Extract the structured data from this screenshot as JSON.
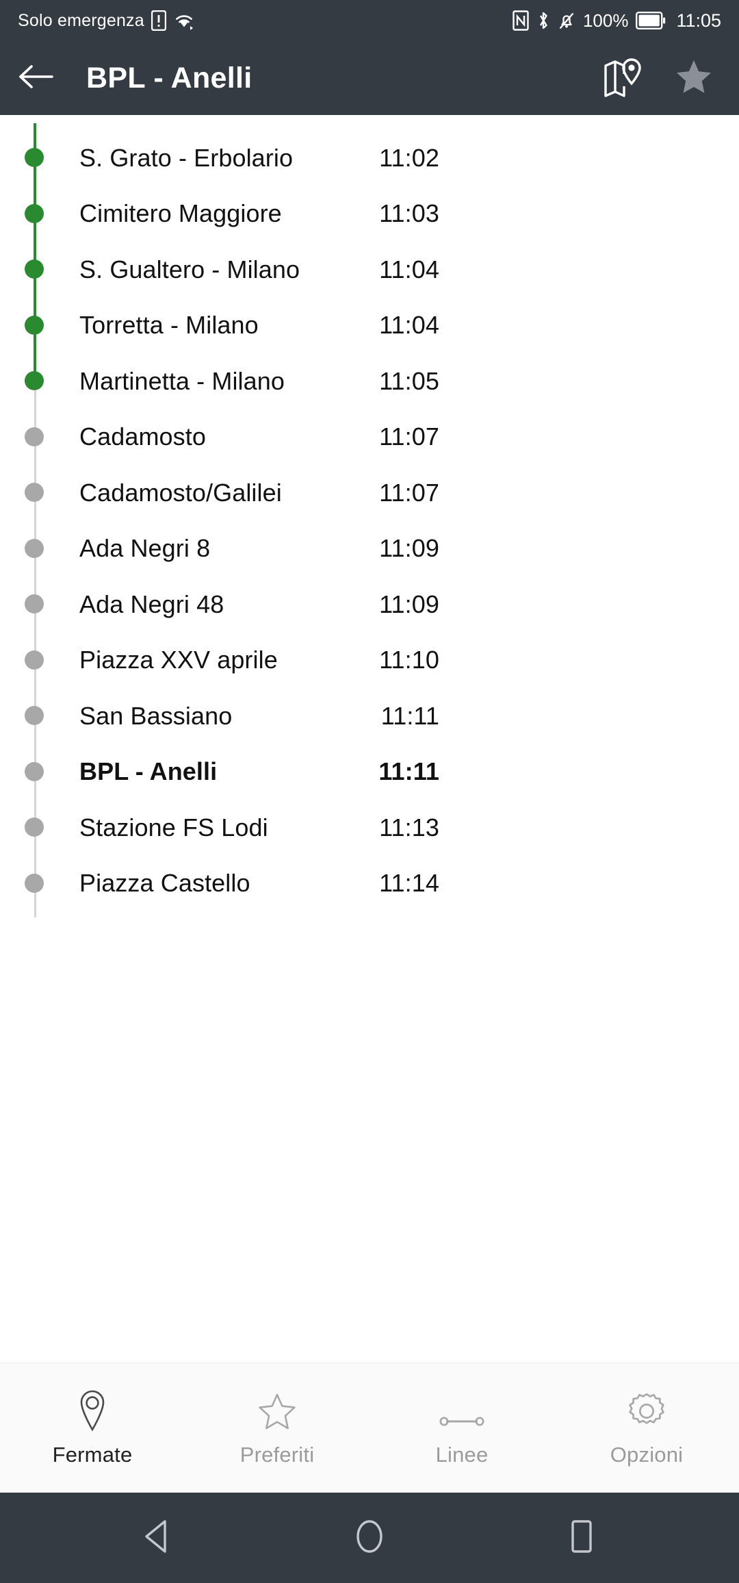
{
  "status_bar": {
    "carrier_text": "Solo emergenza",
    "sim_icon": "sim-alert-icon",
    "wifi_icon": "wifi-icon",
    "nfc_icon": "nfc-icon",
    "bluetooth_icon": "bluetooth-icon",
    "mute_icon": "bell-muted-icon",
    "battery_percent": "100%",
    "battery_icon": "battery-full-icon",
    "clock": "11:05"
  },
  "app_bar": {
    "back_icon": "arrow-left-icon",
    "title": "BPL - Anelli",
    "map_icon": "map-pin-icon",
    "favorite_icon": "star-filled-icon"
  },
  "colors": {
    "app_bar_bg": "#353b43",
    "passed_green": "#2a8a2f",
    "pending_grey": "#a8a8a8",
    "track_grey": "#d5d5d5",
    "nav_active": "#222222",
    "nav_inactive": "#9b9b9b"
  },
  "stops": [
    {
      "name": "S. Grato - Erbolario",
      "time": "11:02",
      "state": "passed",
      "current": false
    },
    {
      "name": "Cimitero Maggiore",
      "time": "11:03",
      "state": "passed",
      "current": false
    },
    {
      "name": "S. Gualtero - Milano",
      "time": "11:04",
      "state": "passed",
      "current": false
    },
    {
      "name": "Torretta - Milano",
      "time": "11:04",
      "state": "passed",
      "current": false
    },
    {
      "name": "Martinetta - Milano",
      "time": "11:05",
      "state": "passed",
      "current": false
    },
    {
      "name": "Cadamosto",
      "time": "11:07",
      "state": "pending",
      "current": false
    },
    {
      "name": "Cadamosto/Galilei",
      "time": "11:07",
      "state": "pending",
      "current": false
    },
    {
      "name": "Ada Negri 8",
      "time": "11:09",
      "state": "pending",
      "current": false
    },
    {
      "name": "Ada Negri 48",
      "time": "11:09",
      "state": "pending",
      "current": false
    },
    {
      "name": "Piazza XXV aprile",
      "time": "11:10",
      "state": "pending",
      "current": false
    },
    {
      "name": "San Bassiano",
      "time": "11:11",
      "state": "pending",
      "current": false
    },
    {
      "name": "BPL - Anelli",
      "time": "11:11",
      "state": "pending",
      "current": true
    },
    {
      "name": "Stazione FS Lodi",
      "time": "11:13",
      "state": "pending",
      "current": false
    },
    {
      "name": "Piazza Castello",
      "time": "11:14",
      "state": "pending",
      "current": false
    }
  ],
  "bottom_nav": {
    "items": [
      {
        "label": "Fermate",
        "icon": "map-pin-icon",
        "active": true
      },
      {
        "label": "Preferiti",
        "icon": "star-outline-icon",
        "active": false
      },
      {
        "label": "Linee",
        "icon": "line-route-icon",
        "active": false
      },
      {
        "label": "Opzioni",
        "icon": "gear-icon",
        "active": false
      }
    ]
  },
  "android_nav": {
    "back": "triangle-back-icon",
    "home": "circle-home-icon",
    "recents": "square-recents-icon"
  }
}
